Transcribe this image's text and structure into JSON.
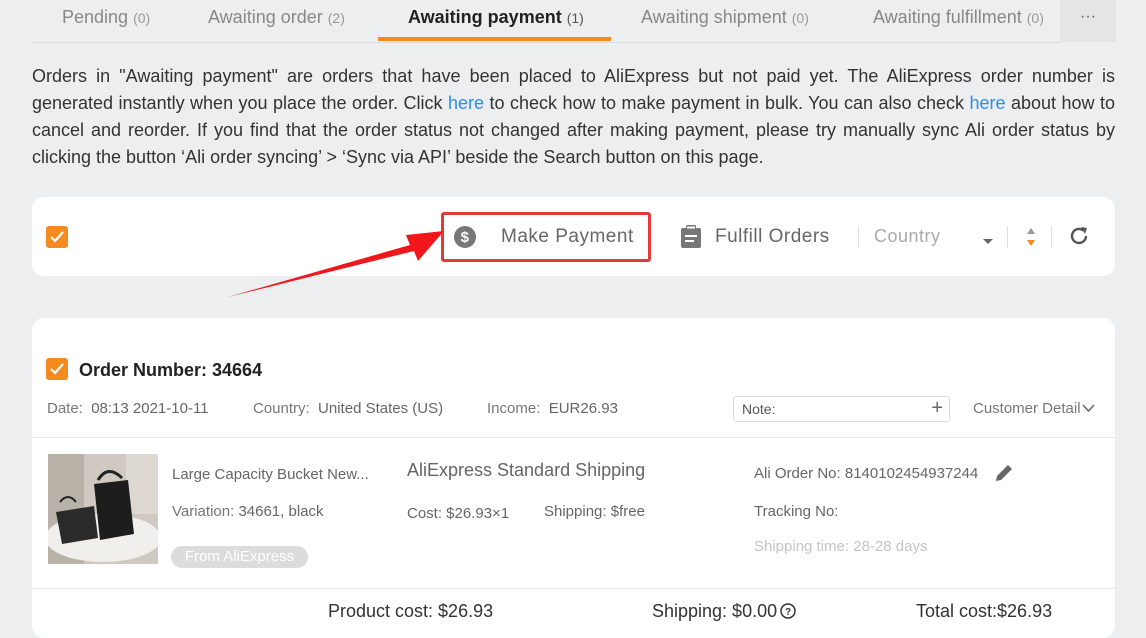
{
  "tabs": [
    {
      "label": "Pending",
      "count": "(0)"
    },
    {
      "label": "Awaiting order",
      "count": "(2)"
    },
    {
      "label": "Awaiting payment",
      "count": "(1)"
    },
    {
      "label": "Awaiting shipment",
      "count": "(0)"
    },
    {
      "label": "Awaiting fulfillment",
      "count": "(0)"
    }
  ],
  "more_label": "···",
  "description": {
    "part1": "Orders in \"Awaiting payment\" are orders that have been placed to AliExpress but not paid yet. The AliExpress order number is generated instantly when you place the order. Click ",
    "link1": "here",
    "part2": " to check how to make payment in bulk. You can also check ",
    "link2": "here",
    "part3": " about how to cancel and reorder. If you find that the order status not changed after making payment, please try manually sync Ali order status by clicking the button ‘Ali order syncing’ > ‘Sync via API’ beside the Search button on this page."
  },
  "toolbar": {
    "make_payment": "Make Payment",
    "fulfill_orders": "Fulfill Orders",
    "country_placeholder": "Country"
  },
  "order": {
    "number_label": "Order Number: 34664",
    "date_label": "Date:",
    "date_value": "08:13 2021-10-11",
    "country_label": "Country:",
    "country_value": "United States (US)",
    "income_label": "Income:",
    "income_value": "EUR26.93",
    "note_label": "Note:",
    "customer_detail": "Customer Detail",
    "product": {
      "title": "Large Capacity Bucket New...",
      "variation_label": "Variation:",
      "variation_value": "34661, black",
      "source_tag": "From AliExpress",
      "shipping_method": "AliExpress Standard Shipping",
      "cost": "Cost: $26.93×1",
      "shipping": "Shipping: $free",
      "ali_order_no": "Ali Order No: 8140102454937244",
      "tracking_no": "Tracking No:",
      "shipping_time": "Shipping time: 28-28 days"
    },
    "totals": {
      "product_cost": "Product cost: $26.93",
      "shipping": "Shipping: $0.00",
      "total_cost": "Total cost:$26.93"
    }
  },
  "colors": {
    "accent": "#f58a1e",
    "link": "#2d8cf0",
    "highlight": "#e53935"
  }
}
